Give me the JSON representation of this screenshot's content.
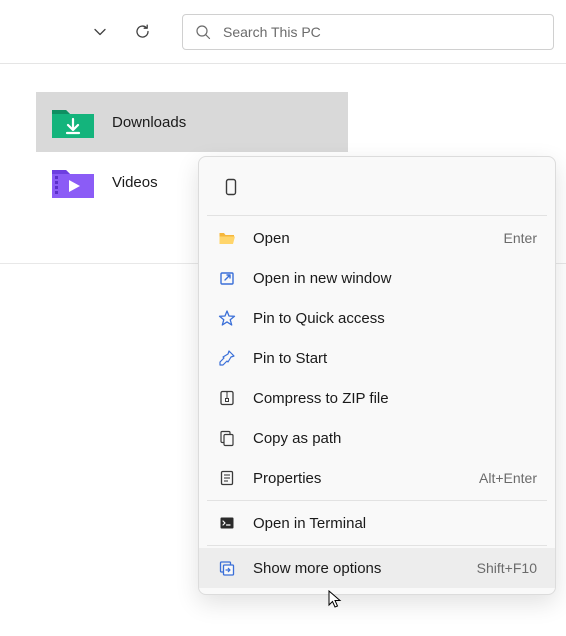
{
  "toolbar": {
    "search_placeholder": "Search This PC"
  },
  "folders": [
    {
      "label": "Downloads",
      "icon": "downloads"
    },
    {
      "label": "Videos",
      "icon": "videos"
    }
  ],
  "context_menu": {
    "items": [
      {
        "icon": "folder-open",
        "label": "Open",
        "accel": "Enter"
      },
      {
        "icon": "open-external",
        "label": "Open in new window",
        "accel": ""
      },
      {
        "icon": "pin-star",
        "label": "Pin to Quick access",
        "accel": ""
      },
      {
        "icon": "pin",
        "label": "Pin to Start",
        "accel": ""
      },
      {
        "icon": "zip",
        "label": "Compress to ZIP file",
        "accel": ""
      },
      {
        "icon": "copy-path",
        "label": "Copy as path",
        "accel": ""
      },
      {
        "icon": "properties",
        "label": "Properties",
        "accel": "Alt+Enter"
      },
      {
        "__sep": true
      },
      {
        "icon": "terminal",
        "label": "Open in Terminal",
        "accel": ""
      },
      {
        "__sep": true
      },
      {
        "icon": "more",
        "label": "Show more options",
        "accel": "Shift+F10",
        "hover": true
      }
    ]
  }
}
